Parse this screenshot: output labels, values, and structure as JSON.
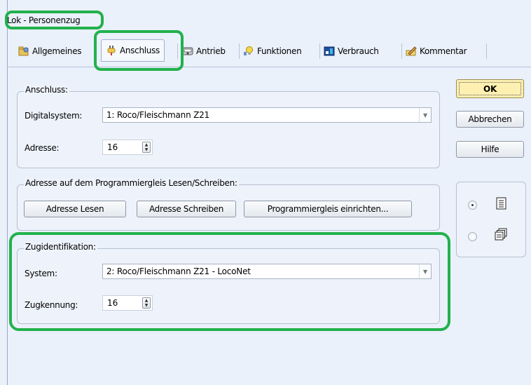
{
  "window": {
    "title": "Lok - Personenzug"
  },
  "tabs": [
    {
      "label": "Allgemeines",
      "icon": "settings-folder-icon"
    },
    {
      "label": "Anschluss",
      "icon": "plug-icon",
      "active": true
    },
    {
      "label": "Antrieb",
      "icon": "motor-icon"
    },
    {
      "label": "Funktionen",
      "icon": "function-bulb-icon"
    },
    {
      "label": "Verbrauch",
      "icon": "consumption-icon"
    },
    {
      "label": "Kommentar",
      "icon": "comment-pencil-icon"
    }
  ],
  "anschluss": {
    "legend": "Anschluss:",
    "digitalsystem_label": "Digitalsystem:",
    "digitalsystem_value": "1: Roco/Fleischmann Z21",
    "adresse_label": "Adresse:",
    "adresse_value": "16"
  },
  "programmiergleis": {
    "legend": "Adresse auf dem Programmiergleis Lesen/Schreiben:",
    "read_button": "Adresse Lesen",
    "write_button": "Adresse Schreiben",
    "setup_button": "Programmiergleis einrichten..."
  },
  "zugidentifikation": {
    "legend": "Zugidentifikation:",
    "system_label": "System:",
    "system_value": "2: Roco/Fleischmann Z21 - LocoNet",
    "zugkennung_label": "Zugkennung:",
    "zugkennung_value": "16"
  },
  "buttons": {
    "ok": "OK",
    "cancel": "Abbrechen",
    "help": "Hilfe"
  },
  "view_options": [
    {
      "icon": "single-page-icon",
      "checked": true
    },
    {
      "icon": "multi-page-icon",
      "checked": false
    }
  ],
  "colors": {
    "highlight": "#22b14c",
    "ok_button": "#fdf0b0",
    "window_bg": "#eaf1fb"
  }
}
